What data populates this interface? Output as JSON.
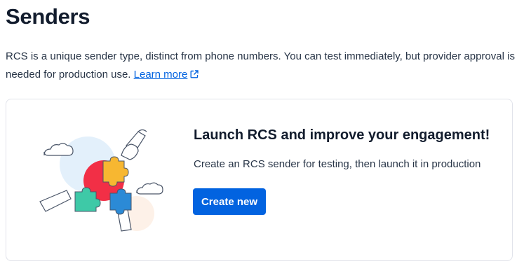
{
  "page": {
    "title": "Senders",
    "intro_text": "RCS is a unique sender type, distinct from phone numbers. You can test immediately, but provider approval is needed for production use. ",
    "learn_more_label": "Learn more"
  },
  "card": {
    "heading": "Launch RCS and improve your engagement!",
    "description": "Create an RCS sender for testing, then launch it in production",
    "create_button_label": "Create new",
    "illustration_icon": "hands-holding-puzzle-pieces-illustration"
  },
  "colors": {
    "link": "#0263e0",
    "button": "#0263e0",
    "heading": "#121c2d",
    "body_text": "#283547",
    "card_border": "#e1e3ea"
  }
}
